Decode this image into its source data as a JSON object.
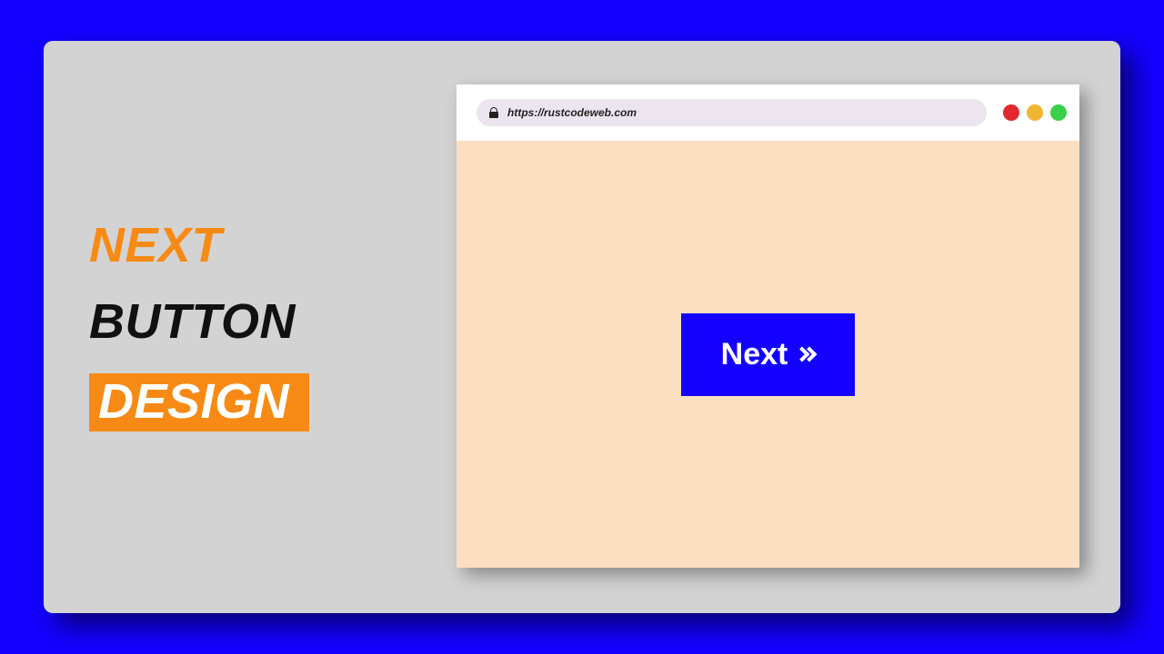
{
  "title": {
    "line1": "NEXT",
    "line2": "BUTTON",
    "line3": "DESIGN"
  },
  "browser": {
    "url": "https://rustcodeweb.com"
  },
  "button": {
    "label": "Next"
  },
  "colors": {
    "page_bg": "#1300ff",
    "card_bg": "#d3d3d3",
    "accent_orange": "#f78a14",
    "viewport_bg": "#fbdfc0",
    "dot_red": "#e2272f",
    "dot_yellow": "#f0b531",
    "dot_green": "#3bd04b"
  }
}
